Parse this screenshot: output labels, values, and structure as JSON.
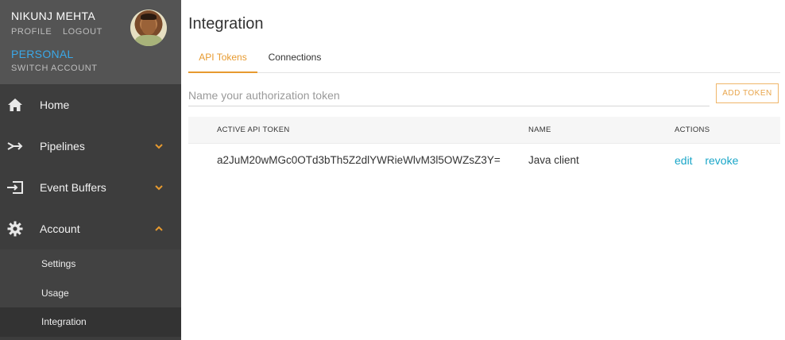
{
  "user": {
    "name": "NIKUNJ MEHTA",
    "profile_link": "PROFILE",
    "logout_link": "LOGOUT",
    "account_type": "PERSONAL",
    "switch_account": "SWITCH ACCOUNT"
  },
  "sidebar": {
    "items": [
      {
        "label": "Home",
        "icon": "home-icon"
      },
      {
        "label": "Pipelines",
        "icon": "pipelines-icon",
        "chevron": "down"
      },
      {
        "label": "Event Buffers",
        "icon": "event-buffers-icon",
        "chevron": "down"
      },
      {
        "label": "Account",
        "icon": "gear-icon",
        "chevron": "up"
      }
    ],
    "account_subitems": [
      {
        "label": "Settings"
      },
      {
        "label": "Usage"
      },
      {
        "label": "Integration",
        "active": true
      }
    ]
  },
  "main": {
    "title": "Integration",
    "tabs": [
      {
        "label": "API Tokens",
        "active": true
      },
      {
        "label": "Connections",
        "active": false
      }
    ],
    "token_input": {
      "placeholder": "Name your authorization token",
      "value": ""
    },
    "add_button": "ADD TOKEN",
    "table": {
      "headers": [
        "ACTIVE API TOKEN",
        "NAME",
        "ACTIONS"
      ],
      "rows": [
        {
          "token": "a2JuM20wMGc0OTd3bTh5Z2dlYWRieWlvM3l5OWZsZ3Y=",
          "name": "Java client",
          "actions": [
            "edit",
            "revoke"
          ]
        }
      ]
    }
  },
  "colors": {
    "accent_orange": "#e79a2f",
    "link_blue": "#1aa6c8",
    "account_blue": "#3aa8e8",
    "sidebar_bg": "#3d3d3d"
  }
}
